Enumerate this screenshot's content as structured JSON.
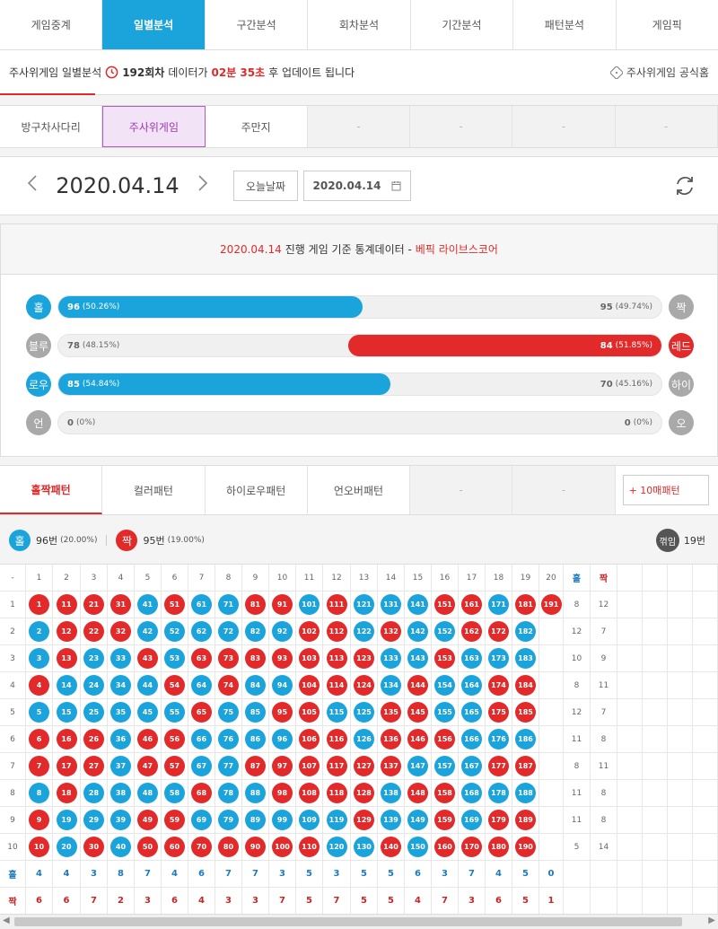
{
  "colors": {
    "blue": "#1ba4db",
    "red": "#e22a2a",
    "gray": "#a9a9a9",
    "purple": "#9a3ab2"
  },
  "nav": {
    "tabs": [
      "게임중계",
      "일별분석",
      "구간분석",
      "회차분석",
      "기간분석",
      "패턴분석",
      "게임픽"
    ],
    "active": 1
  },
  "info": {
    "title": "주사위게임 일별분석",
    "round": "192회차",
    "middle": "데이터가",
    "timer": "02분 35초",
    "suffix": "후 업데이트 됩니다",
    "official": "주사위게임 공식홈"
  },
  "subnav": {
    "tabs": [
      "방구차사다리",
      "주사위게임",
      "주만지",
      "-",
      "-",
      "-",
      "-"
    ],
    "active": 1
  },
  "datebar": {
    "date": "2020.04.14",
    "today_button": "오늘날짜",
    "date_input": "2020.04.14",
    "prev_icon": "chevron-left-icon",
    "next_icon": "chevron-right-icon"
  },
  "stats": {
    "head": {
      "date": "2020.04.14",
      "mid": "진행 게임 기준 통계데이터 -",
      "brand": "베픽 라이브스코어"
    },
    "rows": [
      {
        "left_label": "홀",
        "left_color": "blue",
        "left_value": "96",
        "left_pct": "(50.26%)",
        "right_label": "짝",
        "right_color": "gray",
        "right_value": "95",
        "right_pct": "(49.74%)",
        "fill_side": "left",
        "fill_fraction": 0.5026,
        "fill_color": "blue"
      },
      {
        "left_label": "블루",
        "left_color": "gray",
        "left_value": "78",
        "left_pct": "(48.15%)",
        "right_label": "레드",
        "right_color": "red",
        "right_value": "84",
        "right_pct": "(51.85%)",
        "fill_side": "right",
        "fill_fraction": 0.5185,
        "fill_color": "red"
      },
      {
        "left_label": "로우",
        "left_color": "blue",
        "left_value": "85",
        "left_pct": "(54.84%)",
        "right_label": "하이",
        "right_color": "gray",
        "right_value": "70",
        "right_pct": "(45.16%)",
        "fill_side": "left",
        "fill_fraction": 0.5484,
        "fill_color": "blue"
      },
      {
        "left_label": "언",
        "left_color": "gray",
        "left_value": "0",
        "left_pct": "(0%)",
        "right_label": "오",
        "right_color": "gray",
        "right_value": "0",
        "right_pct": "(0%)",
        "fill_side": "none",
        "fill_fraction": 0,
        "fill_color": "gray"
      }
    ]
  },
  "pattern_tabs": {
    "tabs": [
      "홀짝패턴",
      "컬러패턴",
      "하이로우패턴",
      "언오버패턴",
      "-",
      "-"
    ],
    "active": 0,
    "more": "+ 10매패턴"
  },
  "summary": {
    "odd_label": "홀",
    "odd_count": "96번",
    "odd_pct": "(20.00%)",
    "even_label": "짝",
    "even_count": "95번",
    "even_pct": "(19.00%)",
    "switch_label": "꺾임",
    "switch_count": "19번"
  },
  "grid": {
    "corner": "-",
    "odd_header": "홀",
    "even_header": "짝",
    "odd_row_label": "홀",
    "even_row_label": "짝",
    "colors": [
      "RRRRBRBBRRBRBBBRRBRR",
      "BRRRBBBBBBRRBRBBRRB",
      "BRBBRBRRRRRRRBBRBBB",
      "RBBBBRBRBBRRRBRBBRR",
      "BBBBBBRBBRRBBRRBBRR",
      "RRRBRRBBBBRRBRRRBBB",
      "RRRBRRBBRRRRRRBBBRR",
      "BRBBBBRBBRRRRBRRBBB",
      "RBBBRRBBBBBBRBBRBRR",
      "RBRBRRRRRRRBBRBRRRR"
    ],
    "row_odd": [
      "8",
      "12",
      "10",
      "8",
      "12",
      "11",
      "8",
      "11",
      "11",
      "5"
    ],
    "row_even": [
      "12",
      "7",
      "9",
      "11",
      "7",
      "8",
      "11",
      "8",
      "8",
      "14"
    ],
    "col_odd": [
      "4",
      "4",
      "3",
      "8",
      "7",
      "4",
      "6",
      "7",
      "7",
      "3",
      "5",
      "3",
      "5",
      "5",
      "6",
      "3",
      "7",
      "4",
      "5",
      "0"
    ],
    "col_even": [
      "6",
      "6",
      "7",
      "2",
      "3",
      "6",
      "4",
      "3",
      "3",
      "7",
      "5",
      "7",
      "5",
      "5",
      "4",
      "7",
      "3",
      "6",
      "5",
      "1"
    ]
  }
}
